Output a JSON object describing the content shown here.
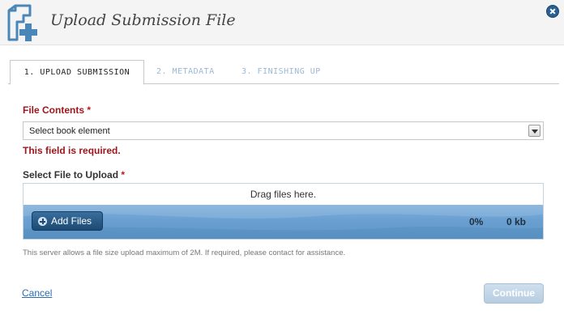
{
  "header": {
    "title": "Upload Submission File",
    "icon": "document-add-icon"
  },
  "tabs": [
    {
      "label": "1. UPLOAD SUBMISSION",
      "active": true
    },
    {
      "label": "2. METADATA",
      "active": false
    },
    {
      "label": "3. FINISHING UP",
      "active": false
    }
  ],
  "form": {
    "file_contents_label": "File Contents",
    "required_marker": "*",
    "file_contents_select": "Select book element",
    "error_text": "This field is required.",
    "select_file_label": "Select File to Upload",
    "drop_text": "Drag files here.",
    "add_files_label": "Add Files",
    "percent": "0%",
    "size": "0 kb",
    "note": "This server allows a file size upload maximum of 2M. If required, please contact for assistance."
  },
  "footer": {
    "cancel_label": "Cancel",
    "continue_label": "Continue"
  },
  "colors": {
    "error": "#a0161c",
    "accent": "#2b5f8f",
    "upload_bar": "#6aa0d1"
  }
}
